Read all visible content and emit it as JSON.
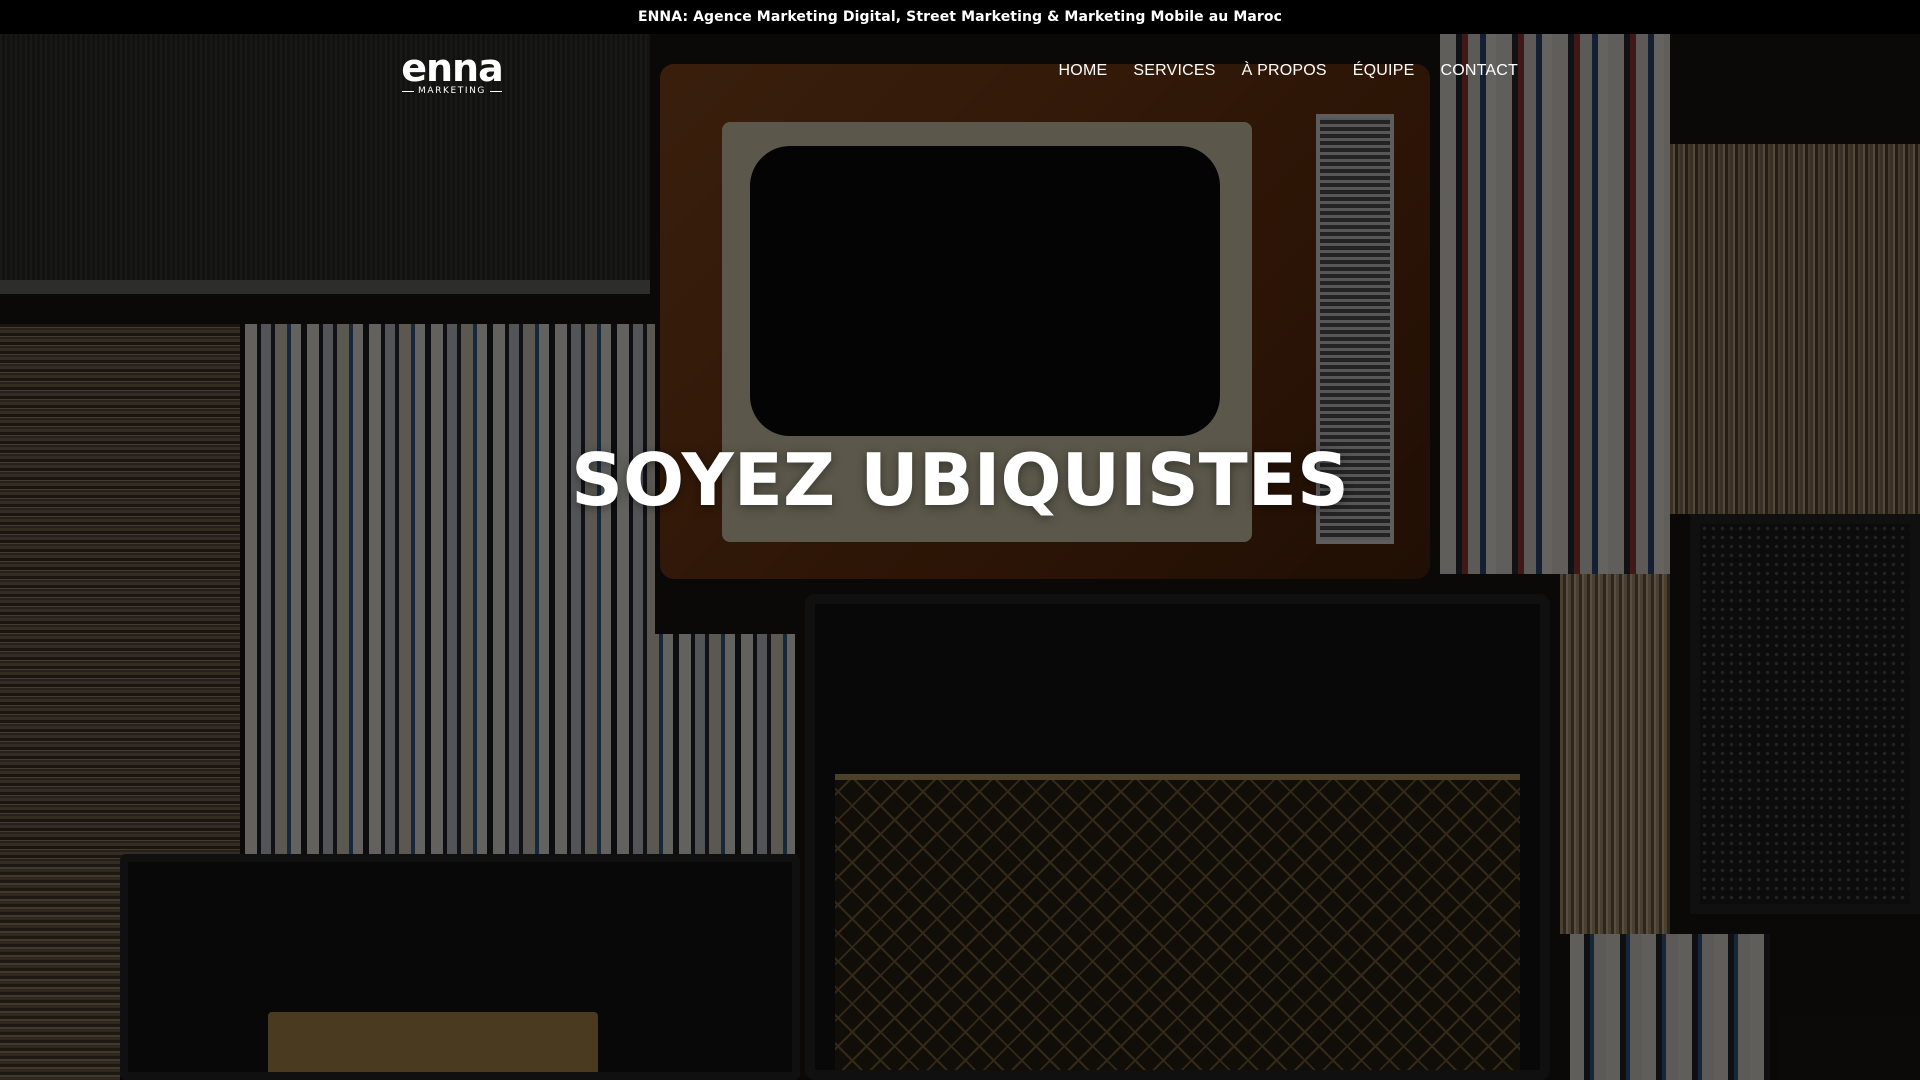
{
  "topbar": {
    "text": "ENNA: Agence Marketing Digital, Street Marketing & Marketing Mobile au Maroc"
  },
  "header": {
    "logo": {
      "main_text": "enna",
      "sub_text": "MARKETING"
    },
    "nav": [
      {
        "label": "HOME"
      },
      {
        "label": "SERVICES"
      },
      {
        "label": "À PROPOS"
      },
      {
        "label": "ÉQUIPE"
      },
      {
        "label": "CONTACT"
      }
    ]
  },
  "hero": {
    "title": "SOYEZ UBIQUISTES",
    "background_description_icon": "retro-media-wall-background"
  },
  "colors": {
    "topbar_bg": "#000000",
    "text": "#ffffff",
    "overlay": "rgba(0,0,0,0.58)"
  }
}
